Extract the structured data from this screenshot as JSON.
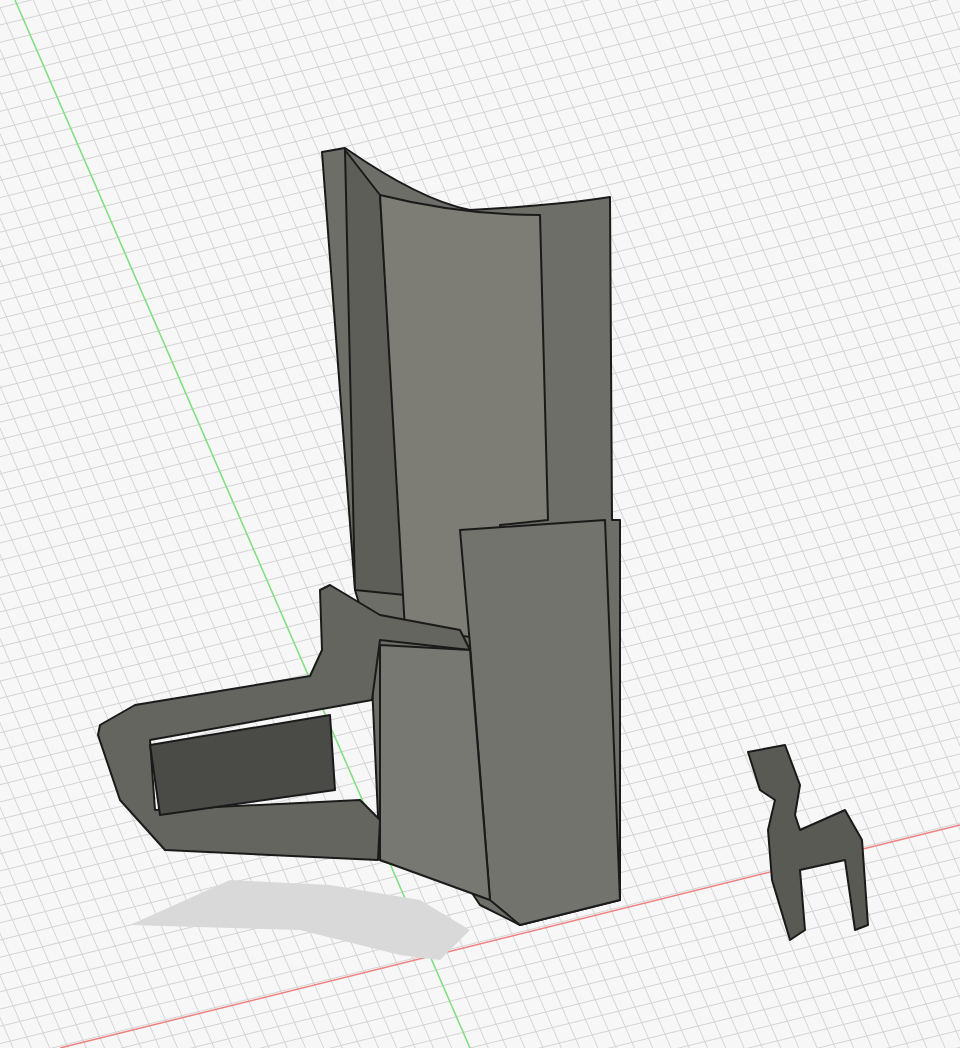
{
  "viewport": {
    "axes": [
      {
        "kind": "x",
        "color": "#f08080"
      },
      {
        "kind": "y",
        "color": "#80e080"
      }
    ]
  }
}
